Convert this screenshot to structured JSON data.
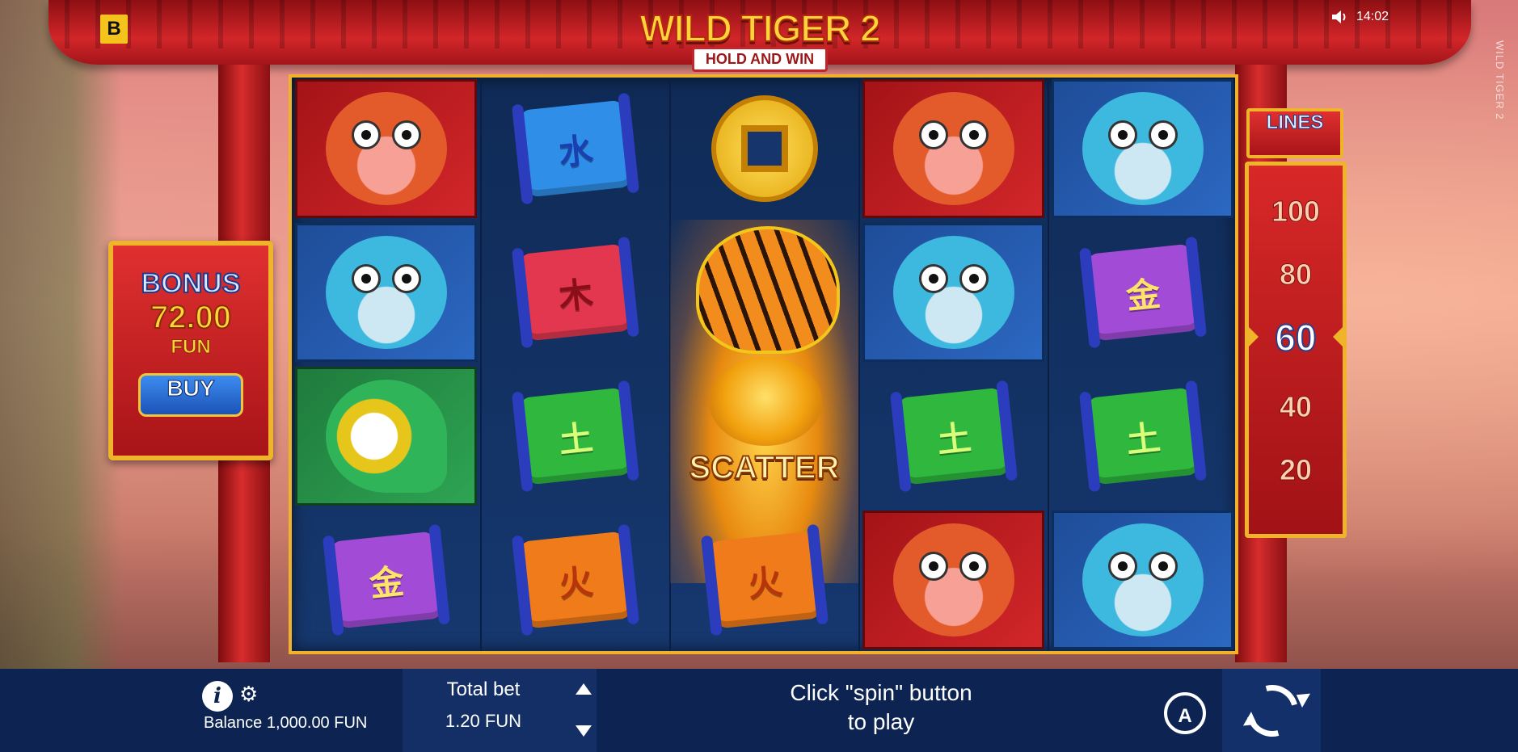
{
  "game": {
    "title_main": "WILD TIGER 2",
    "title_sub": "HOLD AND WIN",
    "vertical_title": "WILD TIGER 2",
    "brand_badge": "B",
    "clock": "14:02"
  },
  "bonus_panel": {
    "title": "BONUS",
    "amount": "72.00",
    "currency": "FUN",
    "buy_label": "BUY"
  },
  "lines_panel": {
    "label": "LINES",
    "values": [
      "100",
      "80",
      "60",
      "40",
      "20"
    ],
    "selected": "60"
  },
  "reels": [
    [
      "ox",
      "frog",
      "crane",
      "scroll-jin"
    ],
    [
      "scroll-shui",
      "scroll-mu",
      "scroll-tu",
      "scroll-huo"
    ],
    [
      "coin",
      "tiger-wild",
      "scatter",
      "scroll-huo"
    ],
    [
      "ox",
      "frog",
      "scroll-tu",
      "ox"
    ],
    [
      "frog",
      "scroll-jin",
      "scroll-tu",
      "frog"
    ]
  ],
  "symbols": {
    "shui": "水",
    "mu": "木",
    "tu": "土",
    "huo": "火",
    "jin": "金",
    "scatter_label": "SCATTER"
  },
  "bottom_bar": {
    "balance_label": "Balance 1,000.00 FUN",
    "total_bet_label": "Total bet",
    "total_bet_value": "1.20 FUN",
    "message_line1": "Click \"spin\" button",
    "message_line2": "to play",
    "autoplay_label": "A"
  },
  "colors": {
    "bar_bg": "#0d2452",
    "frame_gold": "#f0b42a",
    "temple_red": "#d2262a"
  }
}
